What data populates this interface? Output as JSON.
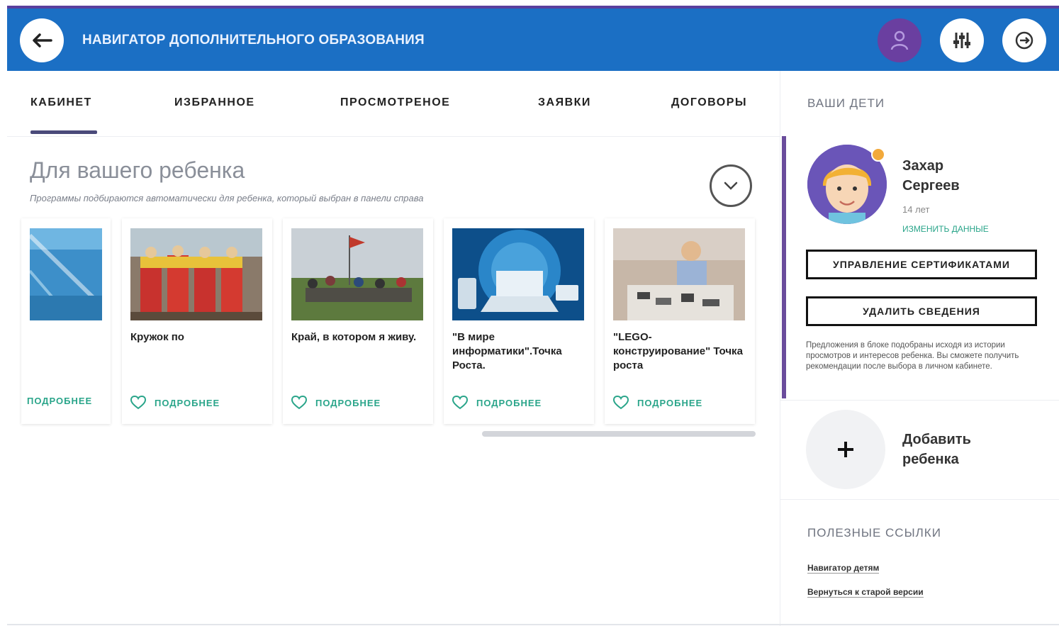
{
  "header": {
    "title": "НАВИГАТОР ДОПОЛНИТЕЛЬНОГО ОБРАЗОВАНИЯ",
    "back_icon": "arrow-left-icon",
    "user_icon": "user-icon",
    "filter_icon": "sliders-icon",
    "exit_icon": "logout-icon",
    "accent_color": "#1b6fc4",
    "user_button_color": "#6a3fa0"
  },
  "tabs": [
    {
      "label": "КАБИНЕТ",
      "active": true
    },
    {
      "label": "ИЗБРАННОЕ",
      "active": false
    },
    {
      "label": "ПРОСМОТРЕНОЕ",
      "active": false
    },
    {
      "label": "ЗАЯВКИ",
      "active": false
    },
    {
      "label": "ДОГОВОРЫ",
      "active": false
    }
  ],
  "recommend": {
    "title": "Для вашего ребенка",
    "subtitle": "Программы подбираются автоматически для ребенка, который выбран в панели справа",
    "cards": [
      {
        "title": "",
        "more": "ПОДРОБНЕЕ"
      },
      {
        "title": "Кружок по",
        "more": "ПОДРОБНЕЕ"
      },
      {
        "title": "Край, в котором я живу.",
        "more": "ПОДРОБНЕЕ"
      },
      {
        "title": "\"В мире информатики\".Точка Роста.",
        "more": "ПОДРОБНЕЕ"
      },
      {
        "title": "\"LEGO-конструирование\" Точка роста",
        "more": "ПОДРОБНЕЕ"
      }
    ]
  },
  "sidebar": {
    "heading": "ВАШИ ДЕТИ",
    "child": {
      "first_name": "Захар",
      "last_name": "Сергеев",
      "age": "14 лет",
      "edit_link": "ИЗМЕНИТЬ ДАННЫЕ"
    },
    "manage_certificates": "УПРАВЛЕНИЕ СЕРТИФИКАТАМИ",
    "delete_info": "УДАЛИТЬ СВЕДЕНИЯ",
    "note": "Предложения в блоке подобраны исходя из истории просмотров и интересов ребенка. Вы сможете получить рекомендации после выбора в личном кабинете.",
    "add_child_line1": "Добавить",
    "add_child_line2": "ребенка",
    "links_heading": "ПОЛЕЗНЫЕ ССЫЛКИ",
    "links": [
      "Навигатор детям",
      "Вернуться к старой версии"
    ]
  }
}
